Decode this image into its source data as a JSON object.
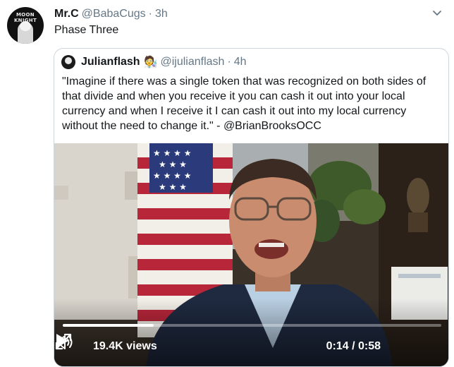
{
  "tweet": {
    "author_name": "Mr.C",
    "author_handle": "@BabaCugs",
    "separator": "·",
    "time": "3h",
    "text": "Phase Three",
    "avatar_logo_lines": [
      "MOON",
      "KNIGHT"
    ]
  },
  "quoted_tweet": {
    "author_name": "Julianflash",
    "emoji": "🧑‍🔬",
    "author_handle": "@ijulianflash",
    "separator": "·",
    "time": "4h",
    "text": "\"Imagine if there was a single token that was recognized on both sides of that divide and when you receive it you can cash it out into your local currency and when I receive it I can cash it out into my local currency without the need to change it.\" - @BrianBrooksOCC"
  },
  "video": {
    "views": "19.4K views",
    "timecode": "0:14 / 0:58",
    "progress_fraction": 0.24,
    "colors": {
      "background": "#3a3129",
      "suit": "#1f2a40",
      "shirt": "#b9cfe2",
      "skin": "#c98c6e",
      "flag_red": "#b8263a",
      "flag_blue": "#2a3a7a"
    }
  },
  "icons": {
    "caret": "chevron-down-icon",
    "play": "play-icon",
    "volume": "volume-icon",
    "fullscreen": "fullscreen-icon"
  }
}
